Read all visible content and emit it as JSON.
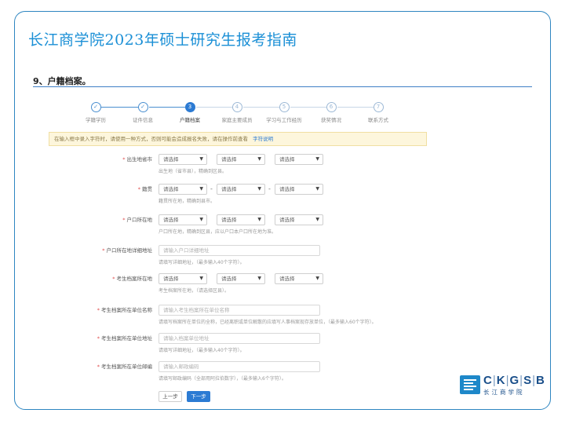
{
  "slide": {
    "title": "长江商学院2023年硕士研究生报考指南",
    "section": "9、户籍档案。"
  },
  "steps": [
    {
      "num": "✓",
      "label": "学籍学历",
      "state": "done"
    },
    {
      "num": "✓",
      "label": "证件信息",
      "state": "done"
    },
    {
      "num": "3",
      "label": "户籍档案",
      "state": "active"
    },
    {
      "num": "4",
      "label": "家庭主要成员",
      "state": "todo"
    },
    {
      "num": "5",
      "label": "学习与工作经历",
      "state": "todo"
    },
    {
      "num": "6",
      "label": "获奖情况",
      "state": "todo"
    },
    {
      "num": "7",
      "label": "联系方式",
      "state": "todo"
    }
  ],
  "notice": {
    "text": "在输入框中录入字符时，请使用一种方式，否则可能会造成报名失败，请在操作前查看",
    "link": "字符说明"
  },
  "fields": {
    "birthplace": {
      "label": "出生地省市",
      "s1": "请选择",
      "s2": "请选择",
      "s3": "请选择",
      "hint": "出生地（省市县），精确到区县。"
    },
    "native": {
      "label": "籍贯",
      "s1": "请选择",
      "s2": "请选择",
      "s3": "请选择",
      "hint": "籍贯所在地，精确到县市。"
    },
    "hukou": {
      "label": "户口所在地",
      "s1": "请选择",
      "s2": "请选择",
      "s3": "请选择",
      "hint": "户口所在地，精确到区县，应以户口本户口所在地为准。"
    },
    "hukou_detail": {
      "label": "户口所在地详细地址",
      "placeholder": "请输入户口详细地址",
      "hint": "请填写详细地址，（最多输入40个字符）。"
    },
    "archive": {
      "label": "考生档案所在地",
      "s1": "请选择",
      "s2": "请选择",
      "s3": "请选择",
      "hint": "考生档案所在地，（请选择区县）。"
    },
    "archive_unit": {
      "label": "考生档案所在单位名称",
      "placeholder": "请输入考生档案所在单位名称",
      "hint": "请填写档案所在单位的全称，已经离职或单位解散的应填写人事档案现存放单位，（最多输入60个字符）。"
    },
    "archive_addr": {
      "label": "考生档案所在单位地址",
      "placeholder": "请输入档案单位地址",
      "hint": "请填写详细地址，（最多输入40个字符）。"
    },
    "archive_zip": {
      "label": "考生档案所在单位邮编",
      "placeholder": "请输入邮政编码",
      "hint": "请填写邮政编码（全部用阿拉伯数字），（最多输入6个字符）。"
    }
  },
  "buttons": {
    "prev": "上一步",
    "next": "下一步"
  },
  "logo": {
    "en": [
      "C",
      "K",
      "G",
      "S",
      "B"
    ],
    "cn": "长江商学院"
  },
  "colors": {
    "accent": "#1a8fd6",
    "primary": "#2c7bd3",
    "frame": "#2e86c1"
  }
}
